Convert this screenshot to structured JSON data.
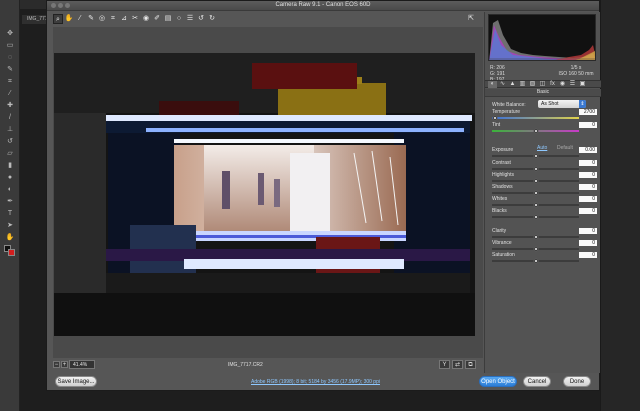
{
  "dialog": {
    "title": "Camera Raw 9.1  -  Canon EOS 60D",
    "filename": "IMG_7717.CR2",
    "zoom": "41.4%",
    "workflow_link": "Adobe RGB (1998); 8 bit; 5184 by 3456 (17.9MP); 300 ppi"
  },
  "background": {
    "doc_tab": "IMG_7717"
  },
  "buttons": {
    "save": "Save Image...",
    "open": "Open Object",
    "cancel": "Cancel",
    "done": "Done"
  },
  "readout": {
    "r": "R:  206",
    "g": "G:  191",
    "b": "B:  197",
    "shutter": "1/5 s",
    "iso": "ISO 160     50 mm"
  },
  "panel": {
    "section": "Basic",
    "white_balance_label": "White Balance:",
    "white_balance_value": "As Shot",
    "auto": "Auto",
    "default": "Default"
  },
  "sliders": [
    {
      "label": "Temperature",
      "value": "2700",
      "level": 0.03
    },
    {
      "label": "Tint",
      "value": "0",
      "level": 0.5
    },
    {
      "label": "Exposure",
      "value": "0.00",
      "level": 0.5
    },
    {
      "label": "Contrast",
      "value": "0",
      "level": 0.5
    },
    {
      "label": "Highlights",
      "value": "0",
      "level": 0.5
    },
    {
      "label": "Shadows",
      "value": "0",
      "level": 0.5
    },
    {
      "label": "Whites",
      "value": "0",
      "level": 0.5
    },
    {
      "label": "Blacks",
      "value": "0",
      "level": 0.5
    },
    {
      "label": "Clarity",
      "value": "0",
      "level": 0.5
    },
    {
      "label": "Vibrance",
      "value": "0",
      "level": 0.5
    },
    {
      "label": "Saturation",
      "value": "0",
      "level": 0.5
    }
  ],
  "tools": [
    "zoom-icon",
    "hand-icon",
    "white-balance-icon",
    "color-sampler-icon",
    "target-adjustment-icon",
    "crop-icon",
    "straighten-icon",
    "spot-removal-icon",
    "red-eye-icon",
    "adjustment-brush-icon",
    "graduated-filter-icon",
    "radial-filter-icon",
    "preferences-icon",
    "rotate-ccw-icon",
    "rotate-cw-icon"
  ],
  "colors": {
    "accent": "#2c7ed8",
    "link": "#8ec8ff",
    "background_swatch": "#d21e1e"
  }
}
